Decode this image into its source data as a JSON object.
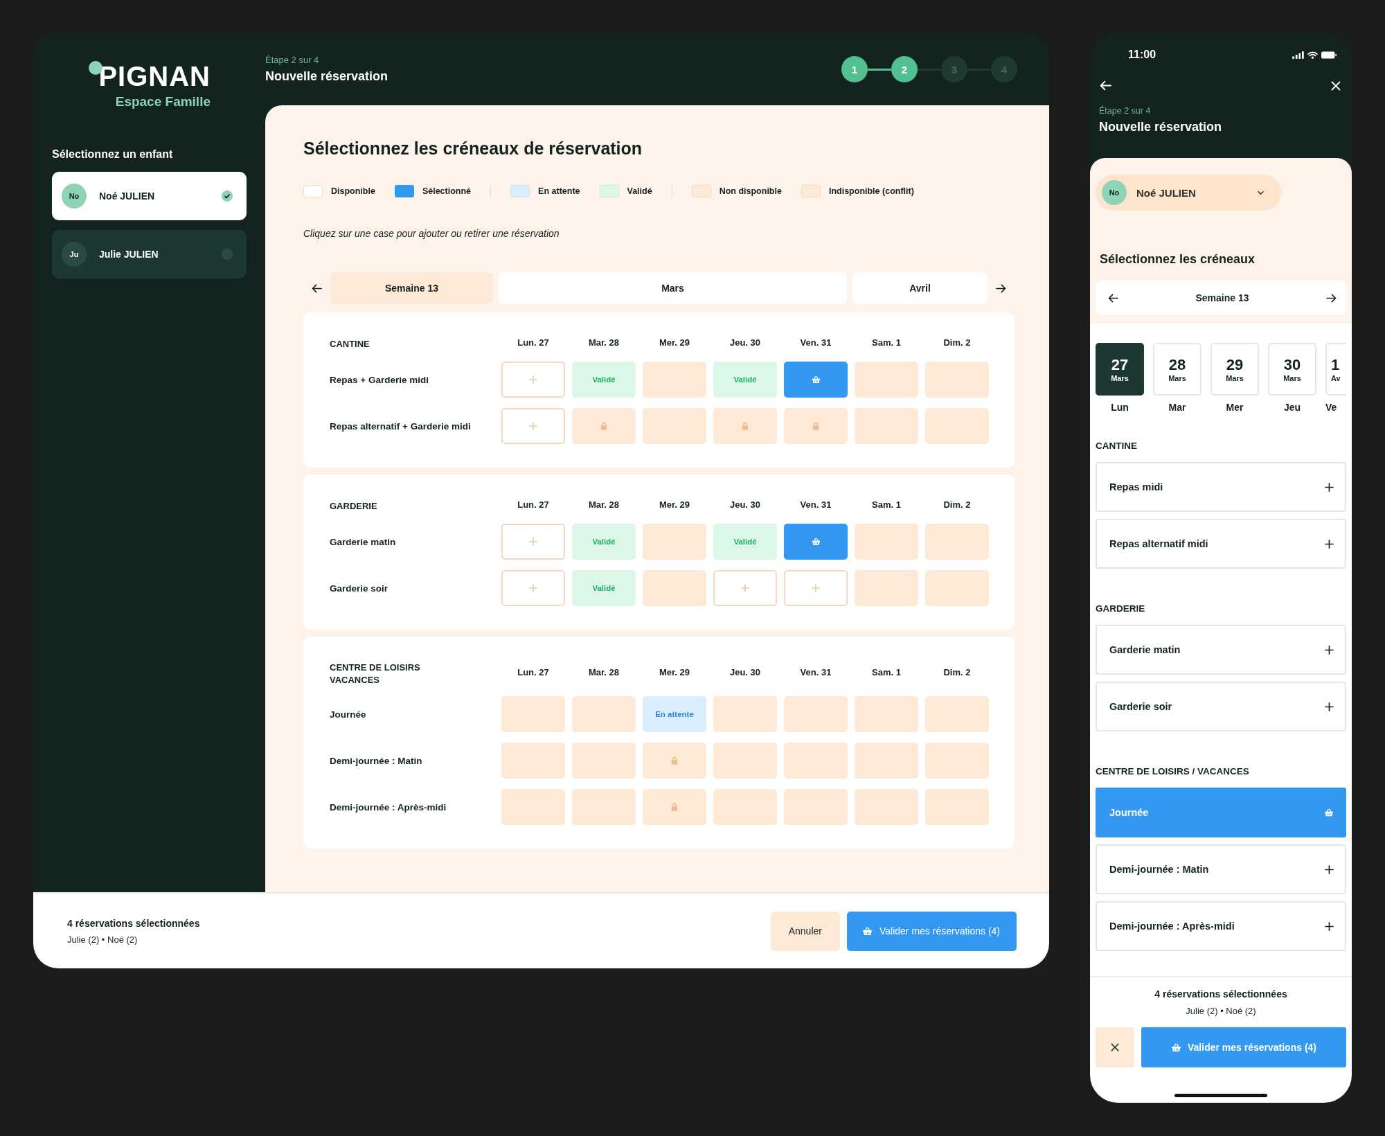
{
  "desktop": {
    "logo": {
      "title": "PIGNAN",
      "subtitle": "Espace Famille"
    },
    "step_label": "Étape 2 sur 4",
    "title": "Nouvelle réservation",
    "stepper": [
      {
        "label": "1",
        "reached": true
      },
      {
        "label": "2",
        "reached": true
      },
      {
        "label": "3",
        "reached": false
      },
      {
        "label": "4",
        "reached": false
      }
    ],
    "sidebar": {
      "heading": "Sélectionnez un enfant",
      "children": [
        {
          "initials": "No",
          "name": "Noé JULIEN",
          "selected": true
        },
        {
          "initials": "Ju",
          "name": "Julie JULIEN",
          "selected": false
        }
      ]
    },
    "panel": {
      "title": "Sélectionnez les créneaux de réservation",
      "legend": [
        {
          "items": [
            {
              "kind": "available",
              "label": "Disponible"
            },
            {
              "kind": "selected",
              "label": "Sélectionné"
            }
          ]
        },
        {
          "items": [
            {
              "kind": "pending",
              "label": "En attente"
            },
            {
              "kind": "validated",
              "label": "Validé"
            }
          ]
        },
        {
          "items": [
            {
              "kind": "unavailable",
              "label": "Non disponible"
            },
            {
              "kind": "locked",
              "label": "Indisponible (conflit)"
            }
          ]
        }
      ],
      "hint": "Cliquez sur une case pour ajouter ou retirer une réservation",
      "week_tabs": [
        {
          "label": "Semaine 13",
          "selected": true
        },
        {
          "label": "Mars",
          "selected": false
        },
        {
          "label": "Avril",
          "selected": false
        }
      ],
      "sections": [
        {
          "title": "CANTINE",
          "days": [
            "Lun. 27",
            "Mar. 28",
            "Mer. 29",
            "Jeu. 30",
            "Ven. 31",
            "Sam. 1",
            "Dim. 2"
          ],
          "rows": [
            {
              "label": "Repas + Garderie midi",
              "cells": [
                {
                  "kind": "available"
                },
                {
                  "kind": "validated",
                  "text": "Validé"
                },
                {
                  "kind": "unavailable"
                },
                {
                  "kind": "validated",
                  "text": "Validé"
                },
                {
                  "kind": "selected"
                },
                {
                  "kind": "unavailable"
                },
                {
                  "kind": "unavailable"
                }
              ]
            },
            {
              "label": "Repas alternatif + Garderie midi",
              "cells": [
                {
                  "kind": "available"
                },
                {
                  "kind": "locked"
                },
                {
                  "kind": "unavailable"
                },
                {
                  "kind": "locked"
                },
                {
                  "kind": "locked"
                },
                {
                  "kind": "unavailable"
                },
                {
                  "kind": "unavailable"
                }
              ]
            }
          ]
        },
        {
          "title": "GARDERIE",
          "days": [
            "Lun. 27",
            "Mar. 28",
            "Mer. 29",
            "Jeu. 30",
            "Ven. 31",
            "Sam. 1",
            "Dim. 2"
          ],
          "rows": [
            {
              "label": "Garderie matin",
              "cells": [
                {
                  "kind": "available"
                },
                {
                  "kind": "validated",
                  "text": "Validé"
                },
                {
                  "kind": "unavailable"
                },
                {
                  "kind": "validated",
                  "text": "Validé"
                },
                {
                  "kind": "selected"
                },
                {
                  "kind": "unavailable"
                },
                {
                  "kind": "unavailable"
                }
              ]
            },
            {
              "label": "Garderie soir",
              "cells": [
                {
                  "kind": "available"
                },
                {
                  "kind": "validated",
                  "text": "Validé"
                },
                {
                  "kind": "unavailable"
                },
                {
                  "kind": "available"
                },
                {
                  "kind": "available"
                },
                {
                  "kind": "unavailable"
                },
                {
                  "kind": "unavailable"
                }
              ]
            }
          ]
        },
        {
          "title": "CENTRE DE LOISIRS VACANCES",
          "days": [
            "Lun. 27",
            "Mar. 28",
            "Mer. 29",
            "Jeu. 30",
            "Ven. 31",
            "Sam. 1",
            "Dim. 2"
          ],
          "rows": [
            {
              "label": "Journée",
              "cells": [
                {
                  "kind": "unavailable"
                },
                {
                  "kind": "unavailable"
                },
                {
                  "kind": "pending",
                  "text": "En attente"
                },
                {
                  "kind": "unavailable"
                },
                {
                  "kind": "unavailable"
                },
                {
                  "kind": "unavailable"
                },
                {
                  "kind": "unavailable"
                }
              ]
            },
            {
              "label": "Demi-journée : Matin",
              "cells": [
                {
                  "kind": "unavailable"
                },
                {
                  "kind": "unavailable"
                },
                {
                  "kind": "locked"
                },
                {
                  "kind": "unavailable"
                },
                {
                  "kind": "unavailable"
                },
                {
                  "kind": "unavailable"
                },
                {
                  "kind": "unavailable"
                }
              ]
            },
            {
              "label": "Demi-journée : Après-midi",
              "cells": [
                {
                  "kind": "unavailable"
                },
                {
                  "kind": "unavailable"
                },
                {
                  "kind": "locked"
                },
                {
                  "kind": "unavailable"
                },
                {
                  "kind": "unavailable"
                },
                {
                  "kind": "unavailable"
                },
                {
                  "kind": "unavailable"
                }
              ]
            }
          ]
        }
      ]
    },
    "footer": {
      "summary": "4 réservations sélectionnées",
      "detail": "Julie (2) • Noé (2)",
      "buttons": [
        {
          "kind": "secondary",
          "label": "Annuler"
        },
        {
          "kind": "primary",
          "label": "Valider mes réservations (4)"
        }
      ]
    }
  },
  "mobile": {
    "time": "11:00",
    "step_label": "Étape 2 sur 4",
    "title": "Nouvelle réservation",
    "child_picker": {
      "initials": "No",
      "name": "Noé JULIEN"
    },
    "heading": "Sélectionnez les créneaux",
    "week": "Semaine 13",
    "days": [
      {
        "day": "27",
        "month": "Mars",
        "weekday": "Lun",
        "selected": true
      },
      {
        "day": "28",
        "month": "Mars",
        "weekday": "Mar",
        "selected": false
      },
      {
        "day": "29",
        "month": "Mars",
        "weekday": "Mer",
        "selected": false
      },
      {
        "day": "30",
        "month": "Mars",
        "weekday": "Jeu",
        "selected": false
      },
      {
        "day": "1",
        "month": "Av",
        "weekday": "Ve",
        "selected": false
      }
    ],
    "sections": [
      {
        "title": "CANTINE",
        "items": [
          {
            "label": "Repas midi",
            "selected": false
          },
          {
            "label": "Repas alternatif midi",
            "selected": false
          }
        ]
      },
      {
        "title": "GARDERIE",
        "items": [
          {
            "label": "Garderie matin",
            "selected": false
          },
          {
            "label": "Garderie soir",
            "selected": false
          }
        ]
      },
      {
        "title": "CENTRE DE LOISIRS / VACANCES",
        "items": [
          {
            "label": "Journée",
            "selected": true
          },
          {
            "label": "Demi-journée : Matin",
            "selected": false
          },
          {
            "label": "Demi-journée : Après-midi",
            "selected": false
          }
        ]
      }
    ],
    "footer": {
      "summary": "4 réservations sélectionnées",
      "detail": "Julie (2) • Noé (2)",
      "confirm": "Valider mes réservations (4)"
    }
  }
}
